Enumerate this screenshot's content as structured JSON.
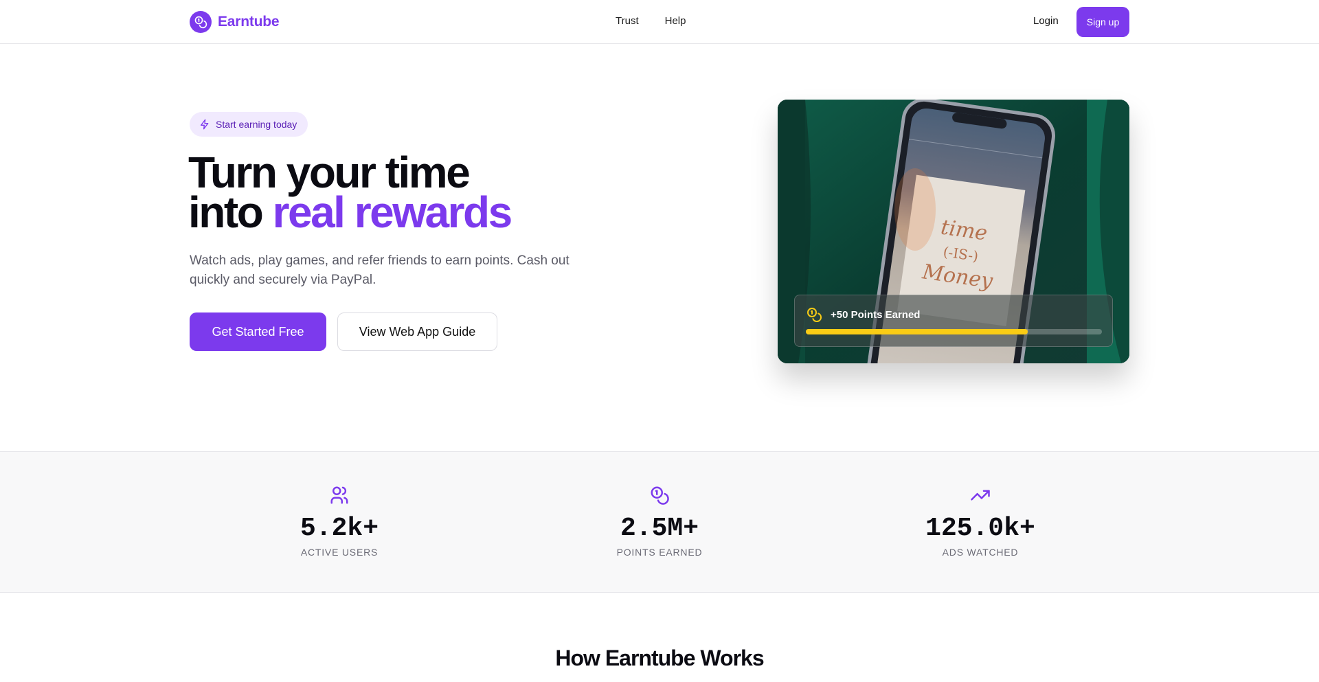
{
  "header": {
    "brand": "Earntube",
    "nav": [
      "Trust",
      "Help"
    ],
    "login": "Login",
    "signup": "Sign up"
  },
  "hero": {
    "badge": "Start earning today",
    "title_line1": "Turn your time",
    "title_line2_prefix": "into ",
    "title_line2_accent": "real rewards",
    "subtitle": "Watch ads, play games, and refer friends to earn points. Cash out quickly and securely via PayPal.",
    "primary_cta": "Get Started Free",
    "secondary_cta": "View Web App Guide",
    "card": {
      "points_text": "+50 Points Earned",
      "progress_fraction": 0.75
    }
  },
  "stats": [
    {
      "value": "5.2k+",
      "label": "ACTIVE USERS",
      "icon": "users-icon"
    },
    {
      "value": "2.5M+",
      "label": "POINTS EARNED",
      "icon": "coins-icon"
    },
    {
      "value": "125.0k+",
      "label": "ADS WATCHED",
      "icon": "trending-up-icon"
    }
  ],
  "section": {
    "title": "How Earntube Works"
  },
  "colors": {
    "brand": "#7c3aed",
    "badge_bg": "#f1eafe",
    "progress": "#facc15"
  }
}
